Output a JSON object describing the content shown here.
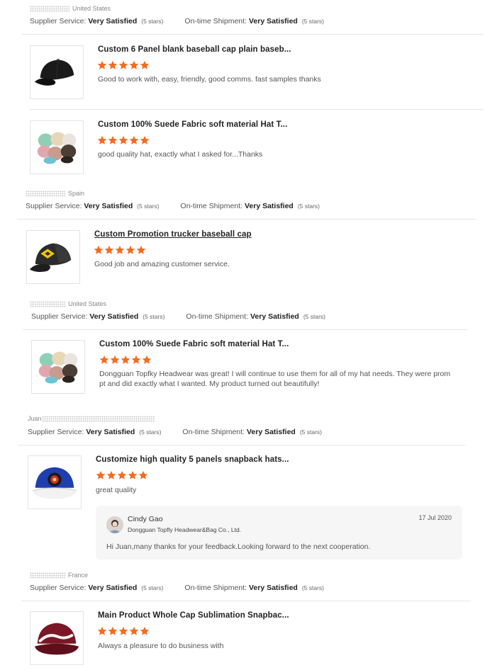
{
  "labels": {
    "supplier_service": "Supplier Service:",
    "ontime_shipment": "On-time Shipment:",
    "very_satisfied": "Very Satisfied",
    "five_stars": "(5 stars)"
  },
  "colors": {
    "star": "#f36c21",
    "divider": "#e6e6e6"
  },
  "reviews": [
    {
      "buyer": {
        "name": "",
        "country": "United States"
      },
      "product": {
        "title": "Custom 6 Panel blank baseball cap plain baseb...",
        "icon": "black-baseball-cap-image",
        "rating": 5,
        "text": "Good to work with, easy, friendly, good comms. fast samples thanks"
      }
    },
    {
      "buyer": null,
      "product": {
        "title": "Custom 100% Suede Fabric soft material Hat T...",
        "icon": "suede-hats-group-image",
        "rating": 5,
        "text": "good quality hat, exactly what I asked for...Thanks"
      }
    },
    {
      "buyer": {
        "name": "",
        "country": "Spain"
      },
      "product": {
        "title": "Custom Promotion trucker baseball cap",
        "icon": "trucker-cap-image",
        "rating": 5,
        "text": "Good job and amazing customer service."
      }
    },
    {
      "buyer": {
        "name": "",
        "country": "United States"
      },
      "product": {
        "title": "Custom 100% Suede Fabric soft material Hat T...",
        "icon": "suede-hats-group-image",
        "rating": 5,
        "text_lines": [
          "Dongguan Topfky Headwear was great! I will continue to use them for all of my hat needs. They were prom",
          "pt and did exactly what I wanted. My product turned out beautifully!"
        ]
      }
    },
    {
      "buyer": {
        "name": "Juan",
        "country": ""
      },
      "product": {
        "title": "Customize high quality 5 panels snapback hats...",
        "icon": "blue-snapback-image",
        "rating": 5,
        "text": "great quality"
      },
      "reply": {
        "name": "Cindy Gao",
        "company": "Dongguan Topfly Headwear&Bag Co., Ltd.",
        "date": "17 Jul 2020",
        "text": "Hi Juan,many thanks for your feedback.Looking forward to the next cooperation."
      }
    },
    {
      "buyer": {
        "name": "",
        "country": "France"
      },
      "product": {
        "title": "Main Product Whole Cap Sublimation Snapbac...",
        "icon": "maroon-snapback-image",
        "rating": 5,
        "text": "Always a pleasure to do business with"
      }
    }
  ]
}
